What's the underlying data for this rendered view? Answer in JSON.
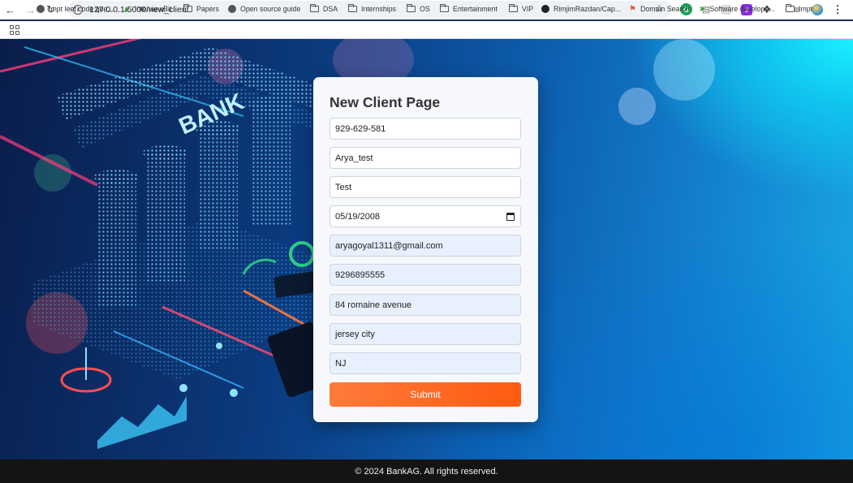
{
  "browser": {
    "url": "127.0.0.1:5000/new_client",
    "bookmarks": [
      {
        "label": "Impt leet code que...",
        "icon": "globe-icon"
      },
      {
        "label": "InterviewBit",
        "icon": "interviewbit-icon"
      },
      {
        "label": "Papers",
        "icon": "folder-icon"
      },
      {
        "label": "Open source guide",
        "icon": "globe-icon"
      },
      {
        "label": "DSA",
        "icon": "folder-icon"
      },
      {
        "label": "Internships",
        "icon": "folder-icon"
      },
      {
        "label": "OS",
        "icon": "folder-icon"
      },
      {
        "label": "Entertainment",
        "icon": "folder-icon"
      },
      {
        "label": "VIP",
        "icon": "folder-icon"
      },
      {
        "label": "RimjimRazdan/Cap...",
        "icon": "github-icon"
      },
      {
        "label": "Domain Search",
        "icon": "domain-search-icon"
      },
      {
        "label": "Software develope...",
        "icon": "software-icon"
      },
      {
        "label": "Impt",
        "icon": "folder-icon"
      }
    ],
    "extension_badge": "2"
  },
  "form": {
    "title": "New Client Page",
    "fields": [
      {
        "value": "929-629-581"
      },
      {
        "value": "Arya_test"
      },
      {
        "value": "Test"
      },
      {
        "value": "05/19/2008"
      },
      {
        "value": "aryagoyal1311@gmail.com"
      },
      {
        "value": "9296895555"
      },
      {
        "value": "84 romaine avenue"
      },
      {
        "value": "jersey city"
      },
      {
        "value": "NJ"
      }
    ],
    "submit_label": "Submit"
  },
  "footer": {
    "text": "© 2024 BankAG. All rights reserved."
  },
  "background": {
    "sign_text": "BANK"
  },
  "colors": {
    "submit_start": "#ff7b3a",
    "submit_end": "#ff5a12",
    "autofill": "#e8f0fe"
  }
}
